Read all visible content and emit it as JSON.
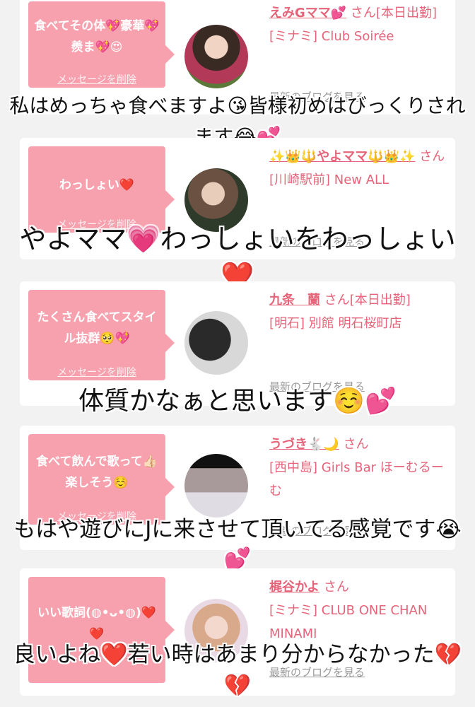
{
  "cards": [
    {
      "message": "食べてその体💖豪華💖羨ま💖😍",
      "delete_label": "メッセージを削除",
      "user": "えみGママ💕",
      "san": "さん[本日出勤]",
      "shop": "[ミナミ] Club Soirée",
      "blog_label": "最新のブログを見る",
      "caption": "私はめっちゃ食べますよ😘皆様初めはびっくりされます😂💕"
    },
    {
      "message": "わっしょい❤️",
      "delete_label": "メッセージを削除",
      "user": "✨👑🔱やよママ🔱👑✨",
      "san": "さん",
      "shop": "[川崎駅前] New ALL",
      "blog_label": "最新のブログを見る",
      "caption": "やよママ💗わっしょいをわっしょい❤️"
    },
    {
      "message": "たくさん食べてスタイル抜群🥺💖",
      "delete_label": "メッセージを削除",
      "user": "九条　蘭",
      "san": "さん[本日出勤]",
      "shop": "[明石] 別館 明石桜町店",
      "blog_label": "最新のブログを見る",
      "caption": "体質かなぁと思います☺️💕"
    },
    {
      "message": "食べて飲んで歌って👍🏻楽しそう☺️",
      "delete_label": "メッセージを削除",
      "user": "うづき🐇🌙",
      "san": "さん",
      "shop": "[西中島] Girls Bar ほーむるーむ",
      "blog_label": "最新のブログを見る",
      "caption": "もはや遊びにJに来させて頂いてる感覚です😭💕"
    },
    {
      "message": "いい歌詞(◍•ᴗ•◍)❤️❤️",
      "delete_label": "メッセージを削除",
      "user": "梶谷かよ",
      "san": "さん",
      "shop": "[ミナミ] CLUB ONE CHAN MINAMI",
      "blog_label": "最新のブログを見る",
      "caption": "良いよね❤️若い時はあまり分からなかった💔💔"
    }
  ]
}
